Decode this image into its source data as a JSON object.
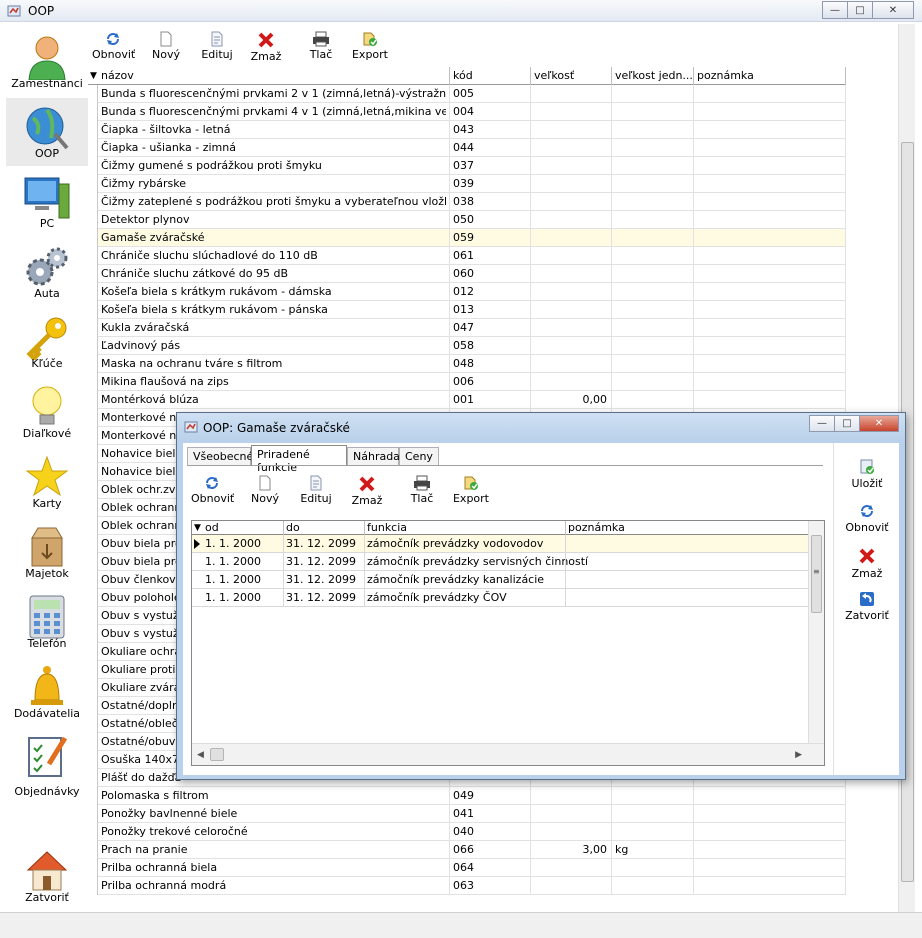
{
  "window": {
    "title": "OOP"
  },
  "sidebar": {
    "items": [
      {
        "label": "Zamestnanci",
        "icon": "person-icon"
      },
      {
        "label": "OOP",
        "icon": "globe-tools-icon"
      },
      {
        "label": "PC",
        "icon": "computer-icon"
      },
      {
        "label": "Auta",
        "icon": "gears-icon"
      },
      {
        "label": "Kľúče",
        "icon": "key-icon"
      },
      {
        "label": "Diaľkové",
        "icon": "lightbulb-icon"
      },
      {
        "label": "Karty",
        "icon": "star-icon"
      },
      {
        "label": "Majetok",
        "icon": "box-icon"
      },
      {
        "label": "Telefón",
        "icon": "phone-keypad-icon"
      },
      {
        "label": "Dodávatelia",
        "icon": "bell-icon"
      },
      {
        "label": "Objednávky",
        "icon": "checklist-icon"
      },
      {
        "label": "Zatvoriť",
        "icon": "house-icon"
      }
    ]
  },
  "toolbar": {
    "refresh": "Obnoviť",
    "new": "Nový",
    "edit": "Edituj",
    "delete": "Zmaž",
    "print": "Tlač",
    "export": "Export"
  },
  "grid": {
    "columns": [
      "názov",
      "kód",
      "veľkosť",
      "veľkost jedn...",
      "poznámka"
    ],
    "rows": [
      [
        "Bunda s fluorescenčnými prvkami  2 v 1 (zimná,letná)-výstražná",
        "005",
        "",
        "",
        ""
      ],
      [
        "Bunda s fluorescenčnými prvkami  4 v 1 (zimná,letná,mikina vesta)",
        "004",
        "",
        "",
        ""
      ],
      [
        "Čiapka  - šiltovka - letná",
        "043",
        "",
        "",
        ""
      ],
      [
        "Čiapka - ušianka  - zimná",
        "044",
        "",
        "",
        ""
      ],
      [
        "Čižmy gumené s podrážkou proti šmyku",
        "037",
        "",
        "",
        ""
      ],
      [
        "Čižmy rybárske",
        "039",
        "",
        "",
        ""
      ],
      [
        "Čižmy zateplené s podrážkou proti šmyku a vyberateľnou vložkou",
        "038",
        "",
        "",
        ""
      ],
      [
        "Detektor plynov",
        "050",
        "",
        "",
        ""
      ],
      [
        "Gamaše zváračské",
        "059",
        "",
        "",
        ""
      ],
      [
        "Chrániče sluchu slúchadlové do 110 dB",
        "061",
        "",
        "",
        ""
      ],
      [
        "Chrániče sluchu zátkové do 95 dB",
        "060",
        "",
        "",
        ""
      ],
      [
        "Košeľa biela s krátkym rukávom - dámska",
        "012",
        "",
        "",
        ""
      ],
      [
        "Košeľa biela s krátkym rukávom - pánska",
        "013",
        "",
        "",
        ""
      ],
      [
        "Kukla zváračská",
        "047",
        "",
        "",
        ""
      ],
      [
        "Ľadvinový pás",
        "058",
        "",
        "",
        ""
      ],
      [
        "Maska na ochranu tváre s filtrom",
        "048",
        "",
        "",
        ""
      ],
      [
        "Mikina flaušová na zips",
        "006",
        "",
        "",
        ""
      ],
      [
        "Montérková blúza",
        "001",
        "0,00",
        "",
        ""
      ],
      [
        "Monterkové no",
        "",
        "",
        "",
        ""
      ],
      [
        "Monterkové no",
        "",
        "",
        "",
        ""
      ],
      [
        "Nohavice biele",
        "",
        "",
        "",
        ""
      ],
      [
        "Nohavice biele",
        "",
        "",
        "",
        ""
      ],
      [
        "Oblek ochr.zvá",
        "",
        "",
        "",
        ""
      ],
      [
        "Oblek ochranny",
        "",
        "",
        "",
        ""
      ],
      [
        "Oblek ochranny",
        "",
        "",
        "",
        ""
      ],
      [
        "Obuv biela pro",
        "",
        "",
        "",
        ""
      ],
      [
        "Obuv biela prot",
        "",
        "",
        "",
        ""
      ],
      [
        "Obuv členková",
        "",
        "",
        "",
        ""
      ],
      [
        "Obuv poloholeň",
        "",
        "",
        "",
        ""
      ],
      [
        "Obuv s vystuže",
        "",
        "",
        "",
        ""
      ],
      [
        "Obuv s vystuže",
        "",
        "",
        "",
        ""
      ],
      [
        "Okuliare ochran",
        "",
        "",
        "",
        ""
      ],
      [
        "Okuliare proti o",
        "",
        "",
        "",
        ""
      ],
      [
        "Okuliare zvárač",
        "",
        "",
        "",
        ""
      ],
      [
        "Ostatné/doplnk",
        "",
        "",
        "",
        ""
      ],
      [
        "Ostatné/oblečen",
        "",
        "",
        "",
        ""
      ],
      [
        "Ostatné/obuv",
        "",
        "",
        "",
        ""
      ],
      [
        "Osuška 140x70",
        "",
        "",
        "",
        ""
      ],
      [
        "Plášť do dažďa",
        "",
        "",
        "",
        ""
      ],
      [
        "Polomaska s filtrom",
        "049",
        "",
        "",
        ""
      ],
      [
        "Ponožky bavlnenné biele",
        "041",
        "",
        "",
        ""
      ],
      [
        "Ponožky trekové celoročné",
        "040",
        "",
        "",
        ""
      ],
      [
        "Prach na pranie",
        "066",
        "3,00",
        "kg",
        ""
      ],
      [
        "Prilba ochranná biela",
        "064",
        "",
        "",
        ""
      ],
      [
        "Prilba ochranná modrá",
        "063",
        "",
        "",
        ""
      ]
    ]
  },
  "dialog": {
    "title": "OOP: Gamaše zváračské",
    "tabs": [
      "Všeobecné",
      "Priradené funkcie",
      "Náhrada",
      "Ceny"
    ],
    "toolbar": {
      "refresh": "Obnoviť",
      "new": "Nový",
      "edit": "Edituj",
      "delete": "Zmaž",
      "print": "Tlač",
      "export": "Export"
    },
    "columns": [
      "od",
      "do",
      "funkcia",
      "poznámka"
    ],
    "rows": [
      [
        "1. 1. 2000",
        "31. 12. 2099",
        "zámočník prevádzky vodovodov",
        ""
      ],
      [
        "1. 1. 2000",
        "31. 12. 2099",
        "zámočník prevádzky servisných činností",
        ""
      ],
      [
        "1. 1. 2000",
        "31. 12. 2099",
        "zámočník prevádzky kanalizácie",
        ""
      ],
      [
        "1. 1. 2000",
        "31. 12. 2099",
        "zámočník prevádzky ČOV",
        ""
      ]
    ],
    "actions": {
      "save": "Uložiť",
      "refresh": "Obnoviť",
      "delete": "Zmaž",
      "close": "Zatvoriť"
    }
  }
}
